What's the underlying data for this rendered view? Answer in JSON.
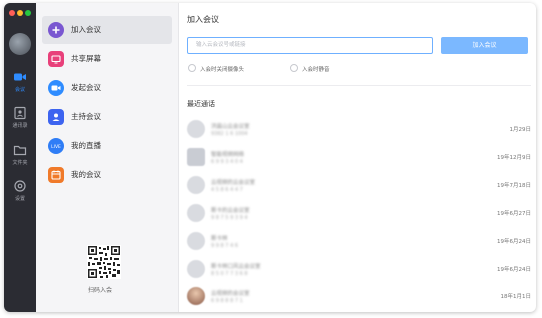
{
  "colors": {
    "accent": "#2f8cff",
    "join_button": "#7bb8ff",
    "rail_bg": "#2b2c33",
    "menu_bg": "#f5f5f7"
  },
  "window_controls": [
    {
      "name": "close",
      "color": "#ff5f57"
    },
    {
      "name": "minimize",
      "color": "#febc2e"
    },
    {
      "name": "maximize",
      "color": "#28c840"
    }
  ],
  "rail": {
    "items": [
      {
        "label": "会议",
        "icon": "video-camera-icon",
        "active": true
      },
      {
        "label": "通讯录",
        "icon": "contacts-book-icon",
        "active": false
      },
      {
        "label": "文件夹",
        "icon": "folder-icon",
        "active": false
      },
      {
        "label": "设置",
        "icon": "gear-icon",
        "active": false
      }
    ]
  },
  "menu": {
    "items": [
      {
        "label": "加入会议",
        "icon": "plus-icon",
        "color": "#7a57d1",
        "active": true
      },
      {
        "label": "共享屏幕",
        "icon": "share-screen-icon",
        "color": "#e8407a",
        "active": false
      },
      {
        "label": "发起会议",
        "icon": "video-camera-icon",
        "color": "#2f8cff",
        "active": false
      },
      {
        "label": "主持会议",
        "icon": "host-icon",
        "color": "#3d64f0",
        "active": false
      },
      {
        "label": "我的直播",
        "icon": "live-icon",
        "color": "#2f7df6",
        "active": false
      },
      {
        "label": "我的会议",
        "icon": "calendar-icon",
        "color": "#f07a2a",
        "active": false
      }
    ],
    "qr_label": "扫码入会"
  },
  "main": {
    "title": "加入会议",
    "search_placeholder": "输入云会议号或链接",
    "join_button": "加入会议",
    "options": [
      "入会时关闭摄像头",
      "入会时静音"
    ],
    "recent_title": "最近通话"
  },
  "recent_calls": [
    {
      "name": "洪晨山云会议室",
      "sub": "9382 1 6 1004",
      "date": "1月29日",
      "avatar": "round"
    },
    {
      "name": "智能视频网络",
      "sub": "6 9 9 3 4 0 4",
      "date": "19年12月9日",
      "avatar": "square"
    },
    {
      "name": "云视频的云会议室",
      "sub": "4 5 8 6 4 4 7",
      "date": "19年7月18日",
      "avatar": "round"
    },
    {
      "name": "斯卡的云会议室",
      "sub": "9 8 7 5 9 3 9 4",
      "date": "19年6月27日",
      "avatar": "round"
    },
    {
      "name": "斯卡林",
      "sub": "9 9 8 7 4 6",
      "date": "19年6月24日",
      "avatar": "round"
    },
    {
      "name": "斯卡林口风云会议室",
      "sub": "8 5 0 7 7 3 6 8",
      "date": "19年6月24日",
      "avatar": "round"
    },
    {
      "name": "云视频的会议室",
      "sub": "6 9 8 8 8 7 1",
      "date": "18年1月1日",
      "avatar": "photo"
    }
  ]
}
